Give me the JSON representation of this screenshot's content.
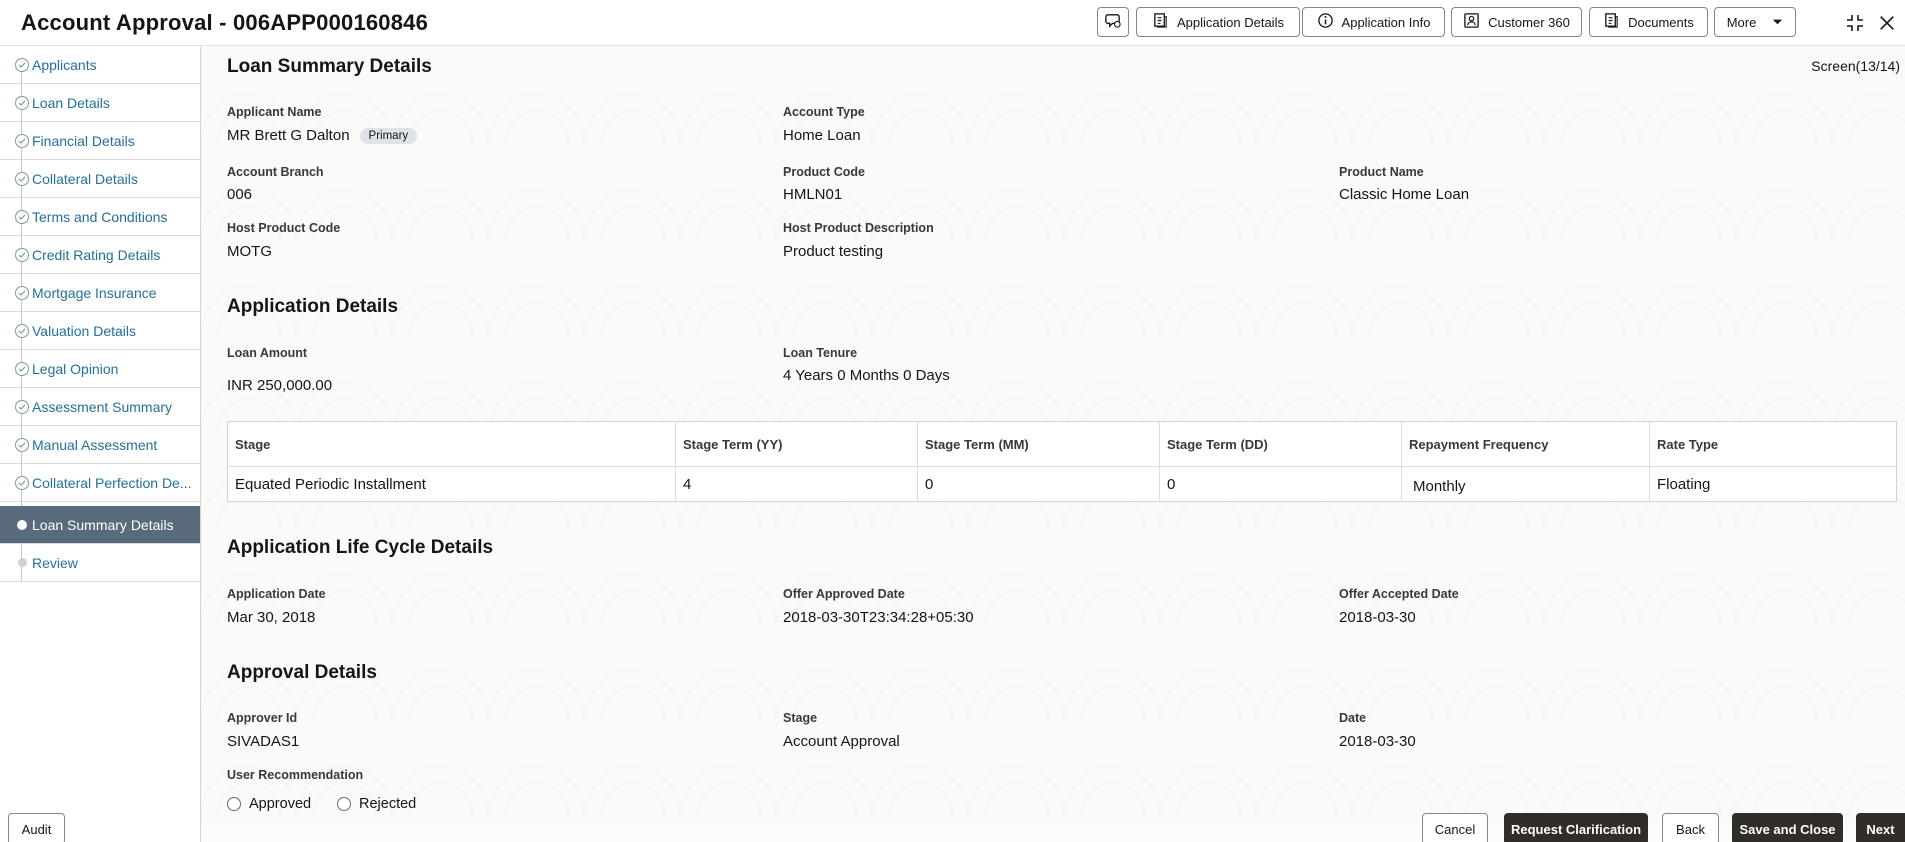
{
  "header": {
    "title": "Account Approval - 006APP000160846",
    "buttons": {
      "application_details": "Application Details",
      "application_info": "Application Info",
      "customer_360": "Customer 360",
      "documents": "Documents",
      "more": "More"
    }
  },
  "sidebar": {
    "items": [
      {
        "label": "Applicants"
      },
      {
        "label": "Loan Details"
      },
      {
        "label": "Financial Details"
      },
      {
        "label": "Collateral Details"
      },
      {
        "label": "Terms and Conditions"
      },
      {
        "label": "Credit Rating Details"
      },
      {
        "label": "Mortgage Insurance"
      },
      {
        "label": "Valuation Details"
      },
      {
        "label": "Legal Opinion"
      },
      {
        "label": "Assessment Summary"
      },
      {
        "label": "Manual Assessment"
      },
      {
        "label": "Collateral Perfection De..."
      },
      {
        "label": "Loan Summary Details"
      },
      {
        "label": "Review"
      }
    ]
  },
  "main": {
    "screen_count": "Screen(13/14)",
    "loan_summary": {
      "title": "Loan Summary Details",
      "applicant_name_label": "Applicant Name",
      "applicant_name": "MR Brett G Dalton",
      "primary_badge": "Primary",
      "account_type_label": "Account Type",
      "account_type": "Home Loan",
      "account_branch_label": "Account Branch",
      "account_branch": "006",
      "product_code_label": "Product Code",
      "product_code": "HMLN01",
      "product_name_label": "Product Name",
      "product_name": "Classic Home Loan",
      "host_product_code_label": "Host Product Code",
      "host_product_code": "MOTG",
      "host_product_desc_label": "Host Product Description",
      "host_product_desc": "Product testing"
    },
    "application_details": {
      "title": "Application Details",
      "loan_amount_label": "Loan Amount",
      "loan_amount": "INR 250,000.00",
      "loan_tenure_label": "Loan Tenure",
      "loan_tenure": "4 Years 0 Months 0 Days",
      "table": {
        "headers": [
          "Stage",
          "Stage Term (YY)",
          "Stage Term (MM)",
          "Stage Term (DD)",
          "Repayment Frequency",
          "Rate Type"
        ],
        "row": [
          "Equated Periodic Installment",
          "4",
          "0",
          "0",
          "Monthly",
          "Floating"
        ]
      }
    },
    "life_cycle": {
      "title": "Application Life Cycle Details",
      "application_date_label": "Application Date",
      "application_date": "Mar 30, 2018",
      "offer_approved_label": "Offer Approved Date",
      "offer_approved": "2018-03-30T23:34:28+05:30",
      "offer_accepted_label": "Offer Accepted Date",
      "offer_accepted": "2018-03-30"
    },
    "approval": {
      "title": "Approval Details",
      "approver_id_label": "Approver Id",
      "approver_id": "SIVADAS1",
      "stage_label": "Stage",
      "stage": "Account Approval",
      "date_label": "Date",
      "date": "2018-03-30",
      "user_recommendation_label": "User Recommendation",
      "options": [
        "Approved",
        "Rejected"
      ]
    }
  },
  "footer": {
    "audit": "Audit",
    "cancel": "Cancel",
    "request_clarification": "Request Clarification",
    "back": "Back",
    "save_and_close": "Save and Close",
    "next": "Next"
  }
}
